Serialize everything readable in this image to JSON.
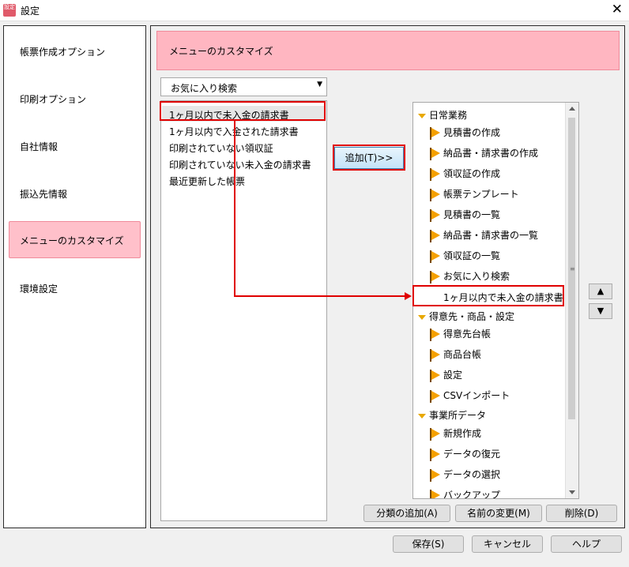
{
  "window": {
    "title": "設定",
    "icon_text": "設定"
  },
  "sidebar": {
    "items": [
      {
        "label": "帳票作成オプション"
      },
      {
        "label": "印刷オプション"
      },
      {
        "label": "自社情報"
      },
      {
        "label": "振込先情報"
      },
      {
        "label": "メニューのカスタマイズ",
        "active": true
      },
      {
        "label": "環境設定"
      }
    ]
  },
  "main": {
    "header": "メニューのカスタマイズ",
    "dropdown": {
      "value": "お気に入り検索"
    },
    "left_list": [
      "1ヶ月以内で未入金の請求書",
      "1ヶ月以内で入金された請求書",
      "印刷されていない領収証",
      "印刷されていない未入金の請求書",
      "最近更新した帳票"
    ],
    "add_button": "追加(T)>>",
    "tree": [
      {
        "type": "group",
        "label": "日常業務"
      },
      {
        "type": "item",
        "label": "見積書の作成"
      },
      {
        "type": "item",
        "label": "納品書・請求書の作成"
      },
      {
        "type": "item",
        "label": "領収証の作成"
      },
      {
        "type": "item",
        "label": "帳票テンプレート"
      },
      {
        "type": "item",
        "label": "見積書の一覧"
      },
      {
        "type": "item",
        "label": "納品書・請求書の一覧"
      },
      {
        "type": "item",
        "label": "領収証の一覧"
      },
      {
        "type": "item",
        "label": "お気に入り検索"
      },
      {
        "type": "sub",
        "label": "1ヶ月以内で未入金の請求書"
      },
      {
        "type": "group",
        "label": "得意先・商品・設定"
      },
      {
        "type": "item",
        "label": "得意先台帳"
      },
      {
        "type": "item",
        "label": "商品台帳"
      },
      {
        "type": "item",
        "label": "設定"
      },
      {
        "type": "item",
        "label": "CSVインポート"
      },
      {
        "type": "group",
        "label": "事業所データ"
      },
      {
        "type": "item",
        "label": "新規作成"
      },
      {
        "type": "item",
        "label": "データの復元"
      },
      {
        "type": "item",
        "label": "データの選択"
      },
      {
        "type": "item",
        "label": "バックアップ"
      }
    ],
    "move_up": "▲",
    "move_down": "▼",
    "category_add": "分類の追加(A)",
    "rename": "名前の変更(M)",
    "delete": "削除(D)"
  },
  "footer": {
    "save": "保存(S)",
    "cancel": "キャンセル",
    "help": "ヘルプ"
  },
  "colors": {
    "accent_pink": "#ffb6c1",
    "highlight_red": "#e00000",
    "flag_orange": "#f5a000"
  }
}
